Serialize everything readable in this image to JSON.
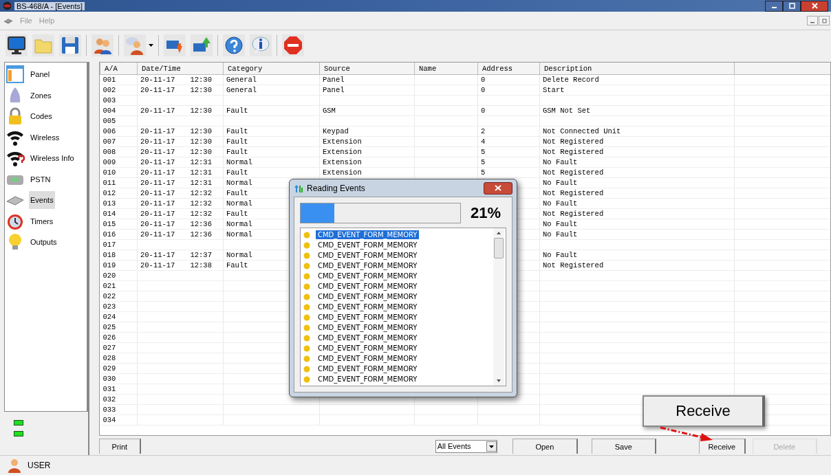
{
  "window": {
    "title": "BS-468/A - [Events]"
  },
  "menu": [
    {
      "label": "File",
      "disabled": true
    },
    {
      "label": "Help",
      "disabled": true
    }
  ],
  "sidebar": {
    "items": [
      {
        "label": "Panel",
        "selected": false
      },
      {
        "label": "Zones",
        "selected": false
      },
      {
        "label": "Codes",
        "selected": false
      },
      {
        "label": "Wireless",
        "selected": false
      },
      {
        "label": "Wireless Info",
        "selected": false
      },
      {
        "label": "PSTN",
        "selected": false
      },
      {
        "label": "Events",
        "selected": true
      },
      {
        "label": "Timers",
        "selected": false
      },
      {
        "label": "Outputs",
        "selected": false
      }
    ]
  },
  "table": {
    "columns": [
      "A/A",
      "Date/Time",
      "Category",
      "Source",
      "Name",
      "Address",
      "Description"
    ],
    "rows": [
      {
        "aa": "001",
        "date": "20-11-17",
        "time": "12:30",
        "category": "General",
        "source": "Panel",
        "address": "0",
        "description": "Delete Record"
      },
      {
        "aa": "002",
        "date": "20-11-17",
        "time": "12:30",
        "category": "General",
        "source": "Panel",
        "address": "0",
        "description": "Start"
      },
      {
        "aa": "003"
      },
      {
        "aa": "004",
        "date": "20-11-17",
        "time": "12:30",
        "category": "Fault",
        "source": "GSM",
        "address": "0",
        "description": "GSM Not Set"
      },
      {
        "aa": "005"
      },
      {
        "aa": "006",
        "date": "20-11-17",
        "time": "12:30",
        "category": "Fault",
        "source": "Keypad",
        "address": "2",
        "description": "Not Connected Unit"
      },
      {
        "aa": "007",
        "date": "20-11-17",
        "time": "12:30",
        "category": "Fault",
        "source": "Extension",
        "address": "4",
        "description": "Not Registered"
      },
      {
        "aa": "008",
        "date": "20-11-17",
        "time": "12:30",
        "category": "Fault",
        "source": "Extension",
        "address": "5",
        "description": "Not Registered"
      },
      {
        "aa": "009",
        "date": "20-11-17",
        "time": "12:31",
        "category": "Normal",
        "source": "Extension",
        "address": "5",
        "description": "No Fault"
      },
      {
        "aa": "010",
        "date": "20-11-17",
        "time": "12:31",
        "category": "Fault",
        "source": "Extension",
        "address": "5",
        "description": "Not Registered"
      },
      {
        "aa": "011",
        "date": "20-11-17",
        "time": "12:31",
        "category": "Normal",
        "description": "No Fault"
      },
      {
        "aa": "012",
        "date": "20-11-17",
        "time": "12:32",
        "category": "Fault",
        "description": "Not Registered"
      },
      {
        "aa": "013",
        "date": "20-11-17",
        "time": "12:32",
        "category": "Normal",
        "description": "No Fault"
      },
      {
        "aa": "014",
        "date": "20-11-17",
        "time": "12:32",
        "category": "Fault",
        "description": "Not Registered"
      },
      {
        "aa": "015",
        "date": "20-11-17",
        "time": "12:36",
        "category": "Normal",
        "description": "No Fault"
      },
      {
        "aa": "016",
        "date": "20-11-17",
        "time": "12:36",
        "category": "Normal",
        "description": "No Fault"
      },
      {
        "aa": "017"
      },
      {
        "aa": "018",
        "date": "20-11-17",
        "time": "12:37",
        "category": "Normal",
        "description": "No Fault"
      },
      {
        "aa": "019",
        "date": "20-11-17",
        "time": "12:38",
        "category": "Fault",
        "description": "Not Registered"
      },
      {
        "aa": "020"
      },
      {
        "aa": "021"
      },
      {
        "aa": "022"
      },
      {
        "aa": "023"
      },
      {
        "aa": "024"
      },
      {
        "aa": "025"
      },
      {
        "aa": "026"
      },
      {
        "aa": "027"
      },
      {
        "aa": "028"
      },
      {
        "aa": "029"
      },
      {
        "aa": "030"
      },
      {
        "aa": "031"
      },
      {
        "aa": "032"
      },
      {
        "aa": "033"
      },
      {
        "aa": "034"
      }
    ]
  },
  "print_button": {
    "label": "Print"
  },
  "filter": {
    "value": "All Events"
  },
  "buttons": [
    {
      "label": "Open",
      "disabled": false
    },
    {
      "label": "Save",
      "disabled": false
    },
    {
      "label": "Receive",
      "disabled": false
    },
    {
      "label": "Delete",
      "disabled": true
    }
  ],
  "callout": {
    "label": "Receive"
  },
  "status_bar": {
    "user": "USER"
  },
  "dialog": {
    "title": "Reading Events",
    "progress": {
      "level": 0.21,
      "reading": "21%"
    },
    "items": [
      {
        "label": "CMD_EVENT_FORM_MEMORY",
        "selected": true
      },
      {
        "label": "CMD_EVENT_FORM_MEMORY",
        "selected": false
      },
      {
        "label": "CMD_EVENT_FORM_MEMORY",
        "selected": false
      },
      {
        "label": "CMD_EVENT_FORM_MEMORY",
        "selected": false
      },
      {
        "label": "CMD_EVENT_FORM_MEMORY",
        "selected": false
      },
      {
        "label": "CMD_EVENT_FORM_MEMORY",
        "selected": false
      },
      {
        "label": "CMD_EVENT_FORM_MEMORY",
        "selected": false
      },
      {
        "label": "CMD_EVENT_FORM_MEMORY",
        "selected": false
      },
      {
        "label": "CMD_EVENT_FORM_MEMORY",
        "selected": false
      },
      {
        "label": "CMD_EVENT_FORM_MEMORY",
        "selected": false
      },
      {
        "label": "CMD_EVENT_FORM_MEMORY",
        "selected": false
      },
      {
        "label": "CMD_EVENT_FORM_MEMORY",
        "selected": false
      },
      {
        "label": "CMD_EVENT_FORM_MEMORY",
        "selected": false
      },
      {
        "label": "CMD_EVENT_FORM_MEMORY",
        "selected": false
      },
      {
        "label": "CMD_EVENT_FORM_MEMORY",
        "selected": false
      }
    ]
  }
}
